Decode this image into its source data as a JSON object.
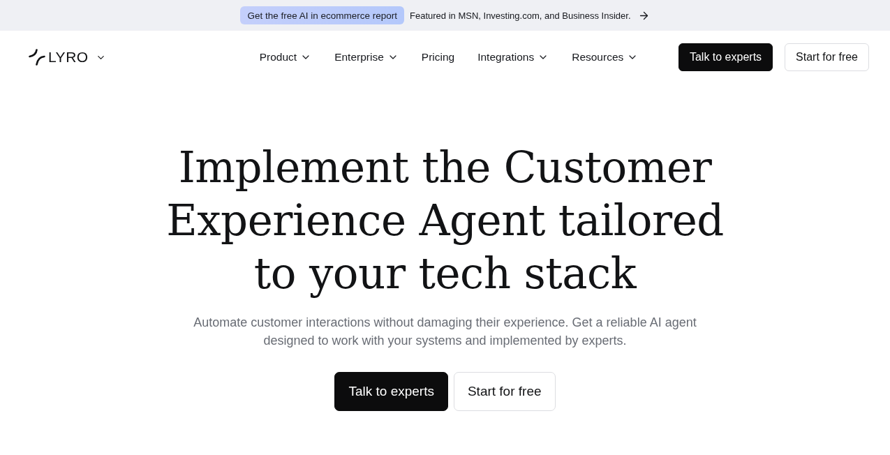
{
  "banner": {
    "badge": "Get the free AI in ecommerce report",
    "text": "Featured in MSN, Investing.com, and Business Insider."
  },
  "header": {
    "logo": "LYRO",
    "nav": [
      {
        "label": "Product",
        "has_menu": true
      },
      {
        "label": "Enterprise",
        "has_menu": true
      },
      {
        "label": "Pricing",
        "has_menu": false
      },
      {
        "label": "Integrations",
        "has_menu": true
      },
      {
        "label": "Resources",
        "has_menu": true
      }
    ],
    "buttons": [
      {
        "label": "Talk to experts",
        "kind": "primary"
      },
      {
        "label": "Start for free",
        "kind": "secondary"
      }
    ]
  },
  "hero": {
    "heading_lines": [
      "Implement the Customer",
      "Experience Agent tailored",
      "to your tech stack"
    ],
    "subtitle": "Automate customer interactions without damaging their experience. Get a reliable AI agent designed to work with your systems and implemented by experts.",
    "buttons": [
      {
        "label": "Talk to experts",
        "kind": "primary"
      },
      {
        "label": "Start for free",
        "kind": "secondary"
      }
    ]
  }
}
